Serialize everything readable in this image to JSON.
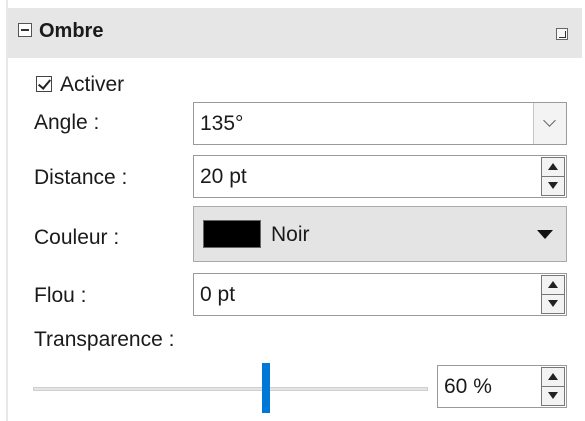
{
  "panel": {
    "title": "Ombre"
  },
  "enable": {
    "label": "Activer",
    "checked": true
  },
  "angle": {
    "label": "Angle :",
    "value": "135°"
  },
  "distance": {
    "label": "Distance :",
    "value": "20 pt"
  },
  "color": {
    "label": "Couleur :",
    "value": "Noir",
    "swatch_hex": "#000000"
  },
  "blur": {
    "label": "Flou :",
    "value": "0 pt"
  },
  "transparency": {
    "label": "Transparence :",
    "value": "60 %",
    "slider_fraction": 0.6
  },
  "icons": {
    "collapse": "minus-box-icon",
    "more_options": "more-options-icon",
    "dropdown": "chevron-down-icon",
    "spin_up": "caret-up-icon",
    "spin_down": "caret-down-icon"
  },
  "colors": {
    "accent": "#0078d7",
    "header_bg": "#e6e6e6"
  }
}
